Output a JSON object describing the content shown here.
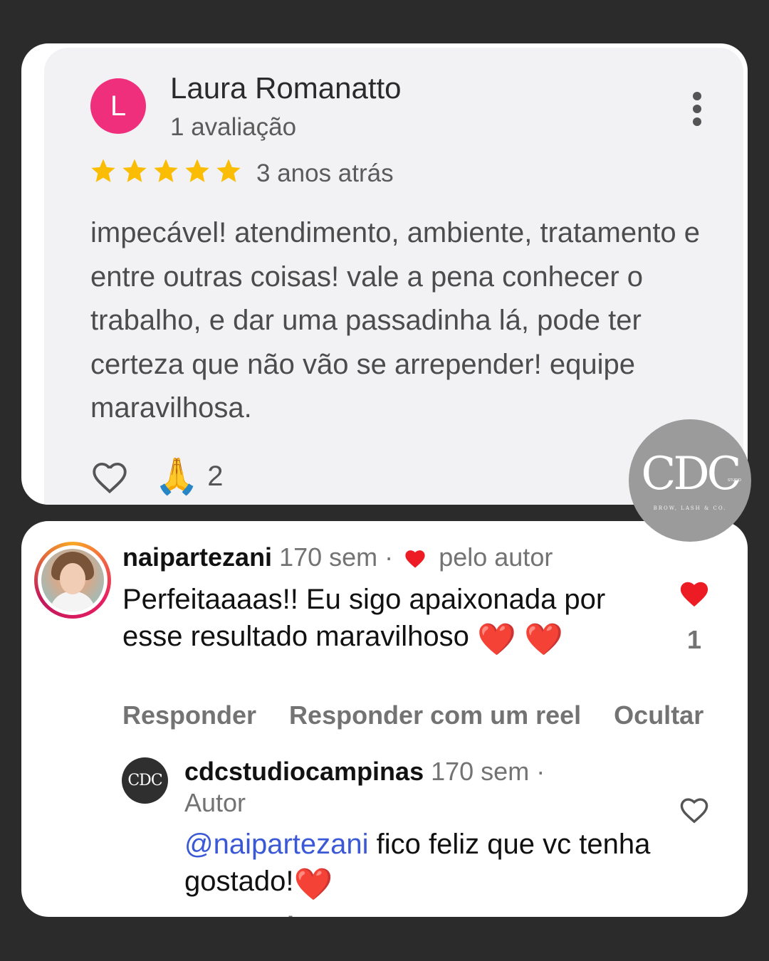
{
  "review": {
    "avatar_letter": "L",
    "avatar_color": "#ef2f7c",
    "reviewer_name": "Laura Romanatto",
    "review_count": "1 avaliação",
    "rating": 5,
    "time_ago": "3 anos atrás",
    "text": "impecável! atendimento, ambiente, tratamento e entre outras coisas! vale a pena conhecer o trabalho, e dar uma passadinha lá, pode ter certeza que não vão se arrepender! equipe maravilhosa.",
    "reaction_emoji": "🙏",
    "reaction_count": "2",
    "icons": {
      "menu": "more-vert-icon",
      "like": "heart-outline-icon",
      "star": "star-icon"
    },
    "star_color": "#fbbc04"
  },
  "watermark": {
    "brand": "CDC",
    "sub": "STUDIO",
    "tagline": "BROW, LASH & CO."
  },
  "comments": {
    "comment1": {
      "username": "naipartezani",
      "age": "170 sem",
      "separator": "·",
      "liked_by": "pelo autor",
      "text": "Perfeitaaaas!! Eu sigo apaixonada por esse resultado maravilhoso",
      "emoji_1": "❤️",
      "emoji_2": "❤️",
      "like_count": "1",
      "liked": true,
      "heart_color": "#ed1c24"
    },
    "actions": {
      "reply": "Responder",
      "reply_reel": "Responder com um reel",
      "hide": "Ocultar"
    },
    "comment2": {
      "avatar_text": "CDC",
      "username": "cdcstudiocampinas",
      "age": "170 sem",
      "separator": "·",
      "badge": "Autor",
      "mention": "@naipartezani",
      "text": " fico feliz que vc tenha gostado!",
      "emoji": "❤️",
      "liked": false,
      "reply_partial": "Responder"
    }
  }
}
